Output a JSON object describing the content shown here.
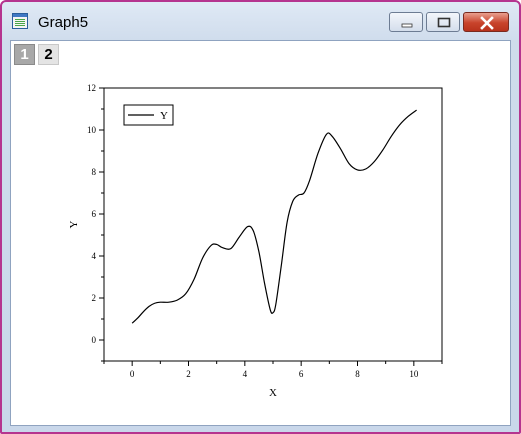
{
  "window": {
    "title": "Graph5"
  },
  "tabs": [
    {
      "label": "1"
    },
    {
      "label": "2"
    }
  ],
  "chart_data": {
    "type": "line",
    "xlabel": "X",
    "ylabel": "Y",
    "xlim": [
      -1,
      11
    ],
    "ylim": [
      -1,
      12
    ],
    "xticks": [
      0,
      2,
      4,
      6,
      8,
      10
    ],
    "yticks": [
      0,
      2,
      4,
      6,
      8,
      10,
      12
    ],
    "legend": "top-left",
    "grid": false,
    "series": [
      {
        "name": "Y",
        "color": "#000000",
        "x": [
          0,
          0.2,
          0.4,
          0.6,
          0.8,
          1.0,
          1.3,
          1.6,
          1.9,
          2.2,
          2.5,
          2.8,
          3.0,
          3.2,
          3.5,
          3.8,
          4.1,
          4.3,
          4.5,
          4.7,
          4.9,
          5.0,
          5.1,
          5.3,
          5.5,
          5.7,
          5.9,
          6.1,
          6.3,
          6.6,
          6.9,
          7.1,
          7.4,
          7.7,
          8.0,
          8.3,
          8.6,
          8.9,
          9.2,
          9.5,
          9.8,
          10.1
        ],
        "values": [
          0.8,
          1.05,
          1.35,
          1.6,
          1.75,
          1.8,
          1.8,
          1.9,
          2.2,
          2.9,
          3.9,
          4.5,
          4.55,
          4.4,
          4.35,
          4.9,
          5.4,
          5.2,
          4.2,
          2.7,
          1.45,
          1.3,
          1.7,
          3.6,
          5.6,
          6.6,
          6.9,
          7.0,
          7.6,
          8.9,
          9.8,
          9.7,
          9.1,
          8.4,
          8.1,
          8.15,
          8.5,
          9.05,
          9.7,
          10.25,
          10.65,
          10.95
        ]
      }
    ]
  }
}
